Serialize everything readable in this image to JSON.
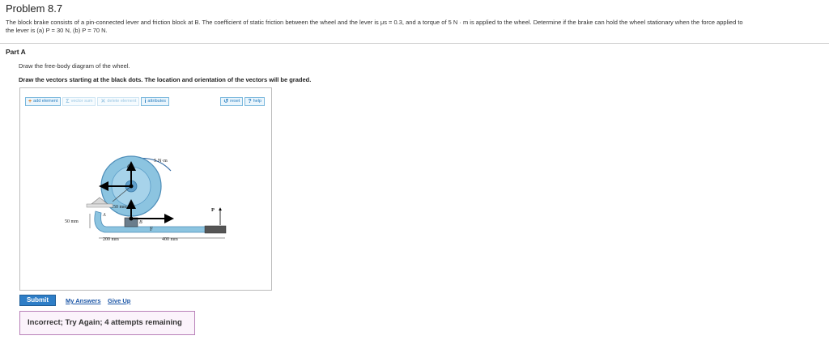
{
  "problem": {
    "title": "Problem 8.7",
    "statement_line1": "The block brake consists of a pin-connected lever and friction block at B. The coefficient of static friction between the wheel and the lever is μs = 0.3, and a torque of 5 N · m is applied to the wheel. Determine if the brake can hold the wheel stationary when the force applied to",
    "statement_line2": "the lever is (a) P = 30 N, (b) P = 70 N."
  },
  "part": {
    "label": "Part A",
    "instruction": "Draw the free-body diagram of the wheel.",
    "instruction_bold": "Draw the vectors starting at the black dots. The location and orientation of the vectors will be graded."
  },
  "toolbar": {
    "add_element": "add element",
    "vector_sum": "vector sum",
    "delete_element": "delete element",
    "attributes": "attributes",
    "reset": "reset",
    "help": "help"
  },
  "icons": {
    "add": "plus-icon",
    "vector_sum": "sigma-icon",
    "delete": "x-icon",
    "attributes": "info-icon",
    "reset": "reset-icon",
    "help": "question-icon"
  },
  "diagram": {
    "torque_label": "5 N·m",
    "point_o": "O",
    "radius_label": "150 mm",
    "dim_left": "50 mm",
    "point_a": "A",
    "point_b": "B",
    "force_f": "F",
    "force_p": "P",
    "dim_200": "200 mm",
    "dim_400": "400 mm"
  },
  "actions": {
    "submit": "Submit",
    "my_answers": "My Answers",
    "give_up": "Give Up"
  },
  "feedback": {
    "message": "Incorrect; Try Again; 4 attempts remaining"
  },
  "colors": {
    "accent": "#2e7ec7",
    "wheel": "#8cc4e0",
    "feedback_border": "#b880b8"
  }
}
